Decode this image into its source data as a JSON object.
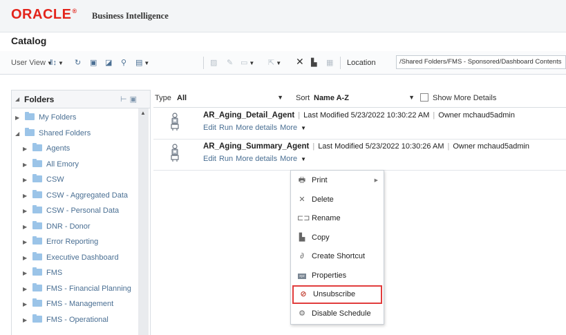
{
  "header": {
    "brand": "ORACLE",
    "reg": "®",
    "product": "Business Intelligence"
  },
  "page": {
    "title": "Catalog"
  },
  "toolbar": {
    "user_view_label": "User View",
    "location_label": "Location",
    "location_value": "/Shared Folders/FMS - Sponsored/Dashboard Contents"
  },
  "folders": {
    "title": "Folders",
    "items": [
      {
        "label": "My Folders",
        "expanded": false,
        "level": 0
      },
      {
        "label": "Shared Folders",
        "expanded": true,
        "level": 0
      },
      {
        "label": "Agents",
        "level": 1
      },
      {
        "label": "All Emory",
        "level": 1
      },
      {
        "label": "CSW",
        "level": 1
      },
      {
        "label": "CSW - Aggregated Data",
        "level": 1
      },
      {
        "label": "CSW - Personal Data",
        "level": 1
      },
      {
        "label": "DNR - Donor",
        "level": 1
      },
      {
        "label": "Error Reporting",
        "level": 1
      },
      {
        "label": "Executive Dashboard",
        "level": 1
      },
      {
        "label": "FMS",
        "level": 1
      },
      {
        "label": "FMS - Financial Planning",
        "level": 1
      },
      {
        "label": "FMS - Management",
        "level": 1
      },
      {
        "label": "FMS - Operational",
        "level": 1
      }
    ]
  },
  "filter": {
    "type_label": "Type",
    "type_value": "All",
    "sort_label": "Sort",
    "sort_value": "Name A-Z",
    "show_more_label": "Show More Details"
  },
  "catalog": {
    "rows": [
      {
        "name": "AR_Aging_Detail_Agent",
        "modified_label": "Last Modified",
        "modified": "5/23/2022 10:30:22 AM",
        "owner_label": "Owner",
        "owner": "mchaud5admin",
        "actions": [
          "Edit",
          "Run",
          "More details",
          "More"
        ]
      },
      {
        "name": "AR_Aging_Summary_Agent",
        "modified_label": "Last Modified",
        "modified": "5/23/2022 10:30:26 AM",
        "owner_label": "Owner",
        "owner": "mchaud5admin",
        "actions": [
          "Edit",
          "Run",
          "More details",
          "More"
        ]
      }
    ]
  },
  "context_menu": {
    "items": [
      {
        "label": "Print",
        "icon": "print-icon",
        "submenu": true
      },
      {
        "label": "Delete",
        "icon": "delete-x-icon"
      },
      {
        "label": "Rename",
        "icon": "rename-icon"
      },
      {
        "label": "Copy",
        "icon": "copy-icon"
      },
      {
        "label": "Create Shortcut",
        "icon": "shortcut-link-icon"
      },
      {
        "label": "Properties",
        "icon": "properties-xyz-icon",
        "icon_text": "xyz"
      },
      {
        "label": "Unsubscribe",
        "icon": "unsubscribe-icon",
        "highlighted": true
      },
      {
        "label": "Disable Schedule",
        "icon": "disable-schedule-icon"
      }
    ]
  },
  "colors": {
    "brand_red": "#e3241b",
    "link_blue": "#4a6f93",
    "highlight_red": "#e13c3c",
    "folder_blue": "#9bc4e8"
  }
}
